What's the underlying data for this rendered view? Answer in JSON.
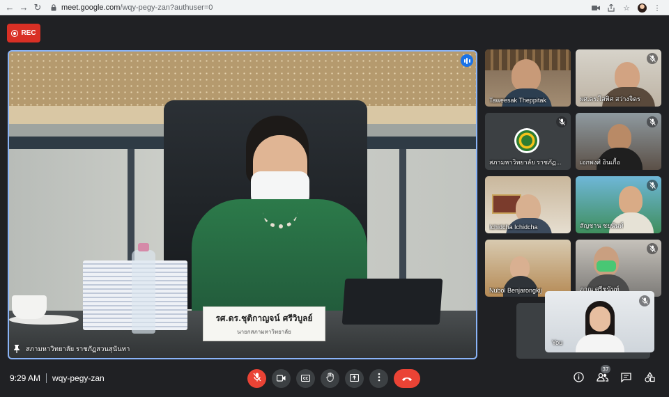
{
  "browser": {
    "url_host": "meet.google.com",
    "url_path": "/wqy-pegy-zan?authuser=0"
  },
  "recording": {
    "label": "REC"
  },
  "stage": {
    "participant_label": "สภามหาวิทยาลัย ราชภัฏสวนสุนันทา",
    "nameplate_name": "รศ.ดร.ชุติกาญจน์ ศรีวิบูลย์",
    "nameplate_title": "นายกสภามหาวิทยาลัย"
  },
  "tiles": [
    {
      "name": "Taweesak Theppitak"
    },
    {
      "name": "ผศ.ดร.ไสพิศ สว่างจิตร"
    },
    {
      "name": "สภามหาวิทยาลัย ราชภัฏ..."
    },
    {
      "name": "เอกพงศ์ อินเกื้อ"
    },
    {
      "name": "Ichidcha Ichidcha"
    },
    {
      "name": "สัญชาน ชยนันท์"
    },
    {
      "name": "Nubol Benjarongkij"
    },
    {
      "name": "ภาณุ ศรีชนันท์"
    }
  ],
  "self": {
    "name": "You"
  },
  "meeting": {
    "time": "9:29 AM",
    "code": "wqy-pegy-zan",
    "participant_count": "37"
  },
  "colors": {
    "accent_blue": "#8ab4f8",
    "danger_red": "#ea4335",
    "rec_red": "#d93025",
    "background": "#202124"
  }
}
